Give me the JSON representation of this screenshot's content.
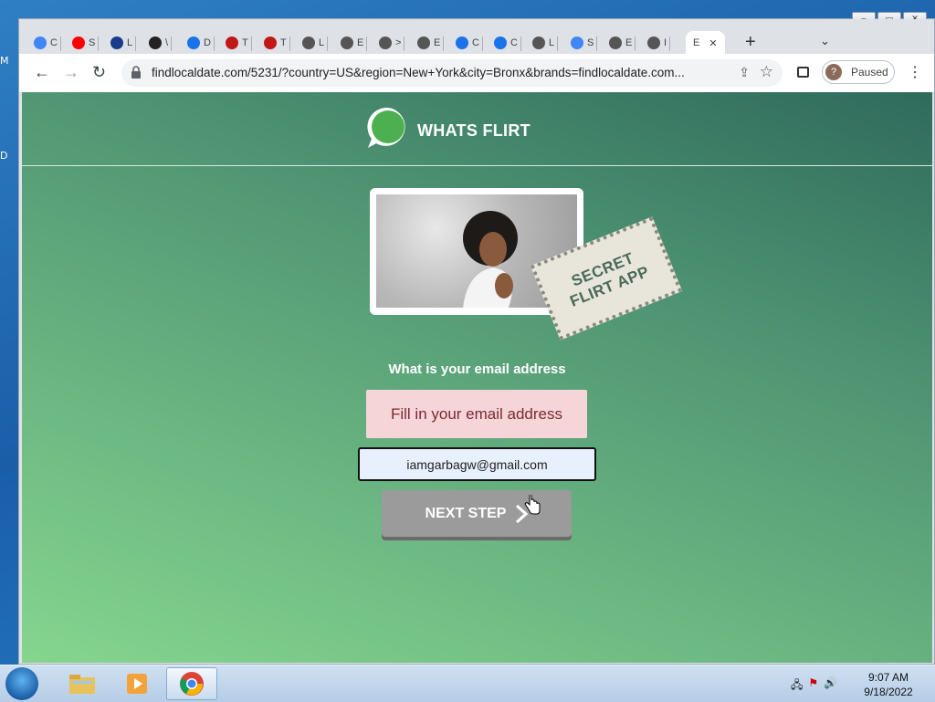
{
  "desktop": {
    "left_letters": [
      "M",
      "D"
    ]
  },
  "window": {
    "controls": [
      "–",
      "▭",
      "✕"
    ]
  },
  "tabs": [
    {
      "label": "C",
      "icon": "google-icon",
      "color": "#4285f4"
    },
    {
      "label": "S",
      "icon": "youtube-icon",
      "color": "#ff0000"
    },
    {
      "label": "L",
      "icon": "link-icon",
      "color": "#1a3a8c"
    },
    {
      "label": "\\",
      "icon": "terminal-icon",
      "color": "#222222"
    },
    {
      "label": "D",
      "icon": "download-icon",
      "color": "#1a73e8"
    },
    {
      "label": "T",
      "icon": "mcafee-icon",
      "color": "#c01818"
    },
    {
      "label": "T",
      "icon": "mcafee-icon",
      "color": "#c01818"
    },
    {
      "label": "L",
      "icon": "globe-icon",
      "color": "#555555"
    },
    {
      "label": "E",
      "icon": "globe-icon",
      "color": "#555555"
    },
    {
      "label": ">",
      "icon": "globe-icon",
      "color": "#555555"
    },
    {
      "label": "E",
      "icon": "globe-icon",
      "color": "#555555"
    },
    {
      "label": "C",
      "icon": "edge-icon",
      "color": "#1a73e8"
    },
    {
      "label": "C",
      "icon": "edge-icon",
      "color": "#1a73e8"
    },
    {
      "label": "L",
      "icon": "globe-icon",
      "color": "#555555"
    },
    {
      "label": "S",
      "icon": "google-icon",
      "color": "#4285f4"
    },
    {
      "label": "E",
      "icon": "globe-icon",
      "color": "#555555"
    },
    {
      "label": "I",
      "icon": "globe-icon",
      "color": "#555555"
    },
    {
      "label": "E",
      "icon": "none",
      "color": "#555555",
      "active": true
    }
  ],
  "toolbar": {
    "url": "findlocaldate.com/5231/?country=US&region=New+York&city=Bronx&brands=findlocaldate.com...",
    "profile_initial": "?",
    "profile_label": "Paused"
  },
  "page": {
    "brand": "WHATS FLIRT",
    "stamp_line1": "SECRET",
    "stamp_line2": "FLIRT APP",
    "question": "What is your email address",
    "error": "Fill in your email address",
    "email_value": "iamgarbagw@gmail.com",
    "next_label": "NEXT STEP"
  },
  "taskbar": {
    "time": "9:07 AM",
    "date": "9/18/2022"
  },
  "colors": {
    "page_gradient_top": "#2f6b5c",
    "page_gradient_bottom": "#86d58e",
    "error_bg": "#f6d5d8",
    "button_bg": "#9b9b9b",
    "logo_green": "#4caf50"
  }
}
